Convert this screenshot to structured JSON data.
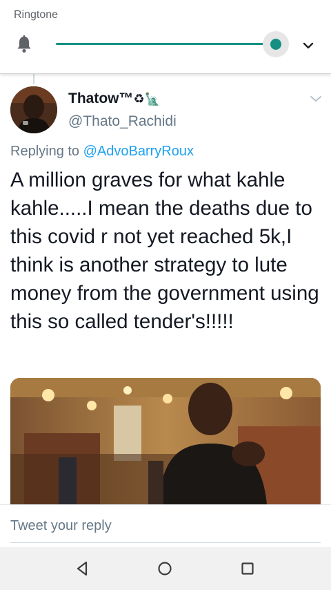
{
  "volume_panel": {
    "title": "Ringtone",
    "level": 0.99,
    "accent_color": "#148f82",
    "icons": {
      "stream": "bell-icon",
      "expand": "chevron-down-icon"
    }
  },
  "tweet": {
    "display_name": "Thatow™",
    "name_emoji": "♻🗽",
    "handle": "@Thato_Rachidi",
    "replying_prefix": "Replying to ",
    "replying_to": "@AdvoBarryRoux",
    "text": "A million graves for what kahle kahle.....I mean the deaths due to this covid r not yet reached 5k,I think is another strategy to lute money from the government using this so called tender's!!!!!",
    "link_color": "#1da1f2"
  },
  "reply": {
    "placeholder": "Tweet your reply"
  },
  "navbar": {
    "buttons": [
      "back-icon",
      "home-icon",
      "recents-icon"
    ]
  }
}
